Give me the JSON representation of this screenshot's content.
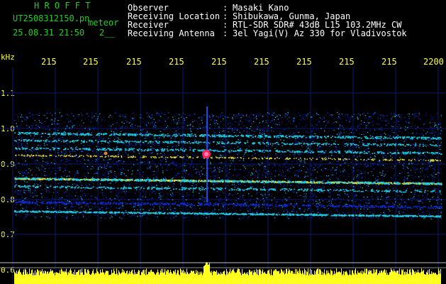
{
  "header": {
    "title": "H R O F F T",
    "filename": "UT2508312150.pn",
    "tag": "meteor",
    "datetime": "25.08.31 21:50",
    "index": "2__",
    "fields": [
      {
        "label": "Observer",
        "value": "Masaki Kano"
      },
      {
        "label": "Receiving Location",
        "value": "Shibukawa, Gunma, Japan"
      },
      {
        "label": "Receiver",
        "value": "RTL-SDR SDR# 43dB L15 103.2MHz CW"
      },
      {
        "label": "Receiving Antenna",
        "value": "3el Yagi(V) Az 330 for Vladivostok"
      }
    ]
  },
  "axis": {
    "unit": "kHz",
    "time_ticks": [
      "215",
      "215",
      "215",
      "215",
      "215",
      "215",
      "215",
      "215",
      "215",
      "2200"
    ],
    "freq_ticks": [
      "1.1",
      "1.0",
      "0.9",
      "0.8",
      "0.7",
      "0.6"
    ]
  },
  "colors": {
    "background": "#000000",
    "text_header": "#ffffff",
    "text_title": "#1fd01f",
    "text_axis": "#ffff40",
    "signal_low": "#0a2bd6",
    "signal_mid": "#18c8e0",
    "signal_high": "#e8e030",
    "echo": "#ff2060"
  }
}
